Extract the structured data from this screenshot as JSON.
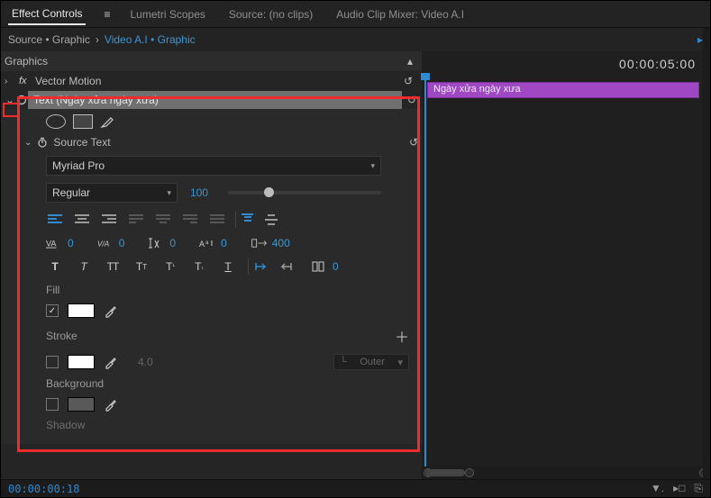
{
  "tabs": {
    "effect_controls": "Effect Controls",
    "lumetri": "Lumetri Scopes",
    "source": "Source: (no clips)",
    "audio_mixer": "Audio Clip Mixer: Video A.I"
  },
  "source_line": {
    "prefix": "Source • Graphic",
    "link": "Video A.I • Graphic"
  },
  "panel": {
    "graphics": "Graphics",
    "vector_motion": "Vector Motion",
    "text_effect": "Text (Ngày xửa ngày xưa)",
    "source_text": "Source Text",
    "font": "Myriad Pro",
    "weight": "Regular",
    "size": "100",
    "tracking": "0",
    "kerning": "0",
    "leading": "0",
    "baseline": "0",
    "tsume": "400",
    "stroke_width": "4.0",
    "fill": "Fill",
    "stroke": "Stroke",
    "background": "Background",
    "shadow": "Shadow",
    "outer": "Outer",
    "fill_color": "#ffffff",
    "stroke_color": "#ffffff",
    "bg_color": "#595959"
  },
  "timeline": {
    "timecode_right": "00:00:05:00",
    "clip_label": "Ngày xửa ngày xưa"
  },
  "footer": {
    "timecode": "00:00:00:18"
  }
}
